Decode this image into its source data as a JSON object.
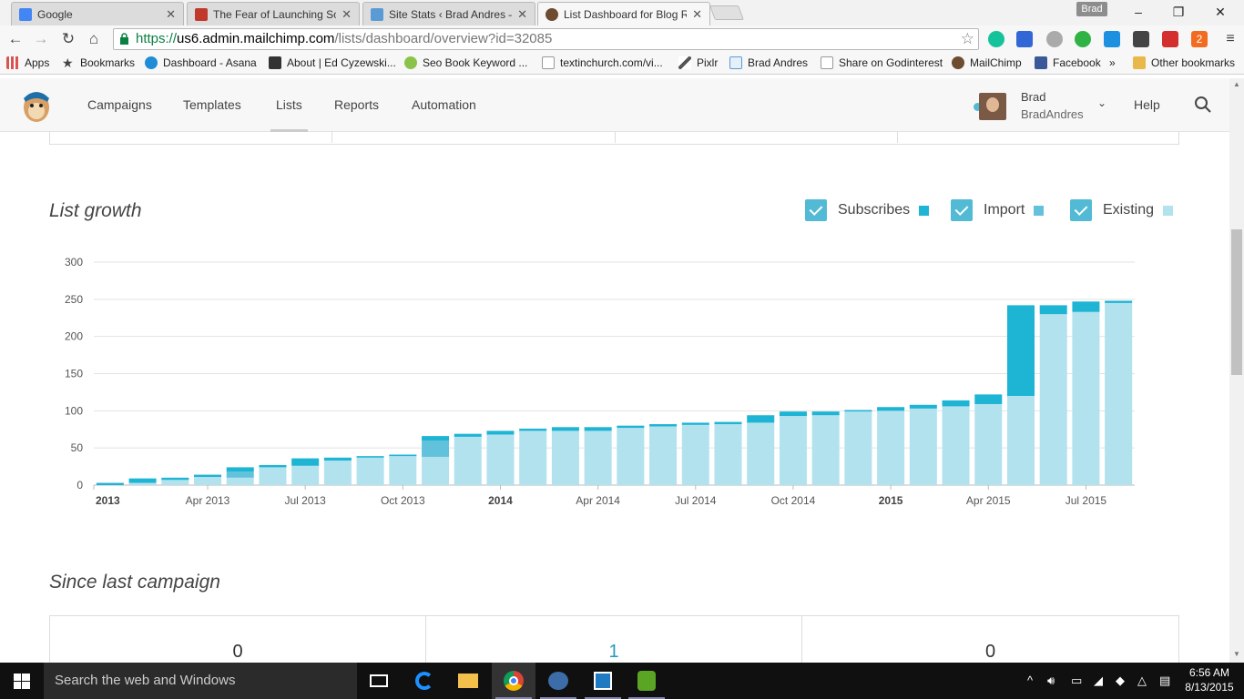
{
  "browser": {
    "tabs": [
      {
        "title": "Google",
        "favicon_color": "#4285f4",
        "active": false
      },
      {
        "title": "The Fear of Launching Sor",
        "favicon_color": "#c0392b",
        "active": false
      },
      {
        "title": "Site Stats ‹ Brad Andres —",
        "favicon_color": "#5b9bd5",
        "active": false
      },
      {
        "title": "List Dashboard for Blog R",
        "favicon_color": "#6d4c2f",
        "active": true
      }
    ],
    "profile_name": "Brad",
    "url": {
      "scheme": "https://",
      "host": "us6.admin.mailchimp.com",
      "path": "/lists/dashboard/overview?id=32085"
    },
    "extension_badge": "2",
    "bookmarks": [
      {
        "label": "Apps",
        "icon": "apps-grid-icon",
        "color": "#d9534f"
      },
      {
        "label": "Bookmarks",
        "icon": "star-icon",
        "color": "#444"
      },
      {
        "label": "Dashboard - Asana",
        "icon": "asana-icon",
        "color": "#1f8dd6"
      },
      {
        "label": "About | Ed Cyzewski...",
        "icon": "site-icon",
        "color": "#333"
      },
      {
        "label": "Seo Book Keyword ...",
        "icon": "seobook-icon",
        "color": "#8bc34a"
      },
      {
        "label": "textinchurch.com/vi...",
        "icon": "page-icon",
        "color": "#999"
      },
      {
        "label": "Pixlr",
        "icon": "pixlr-icon",
        "color": "#555"
      },
      {
        "label": "Brad Andres",
        "icon": "wp-stats-icon",
        "color": "#5b9bd5"
      },
      {
        "label": "Share on Godinterest",
        "icon": "page-icon",
        "color": "#999"
      },
      {
        "label": "MailChimp",
        "icon": "mailchimp-icon",
        "color": "#6d4c2f"
      },
      {
        "label": "Facebook",
        "icon": "facebook-icon",
        "color": "#3b5998"
      },
      {
        "label": "»",
        "icon": "more-icon",
        "color": "#444"
      },
      {
        "label": "Other bookmarks",
        "icon": "folder-icon",
        "color": "#e8b84a"
      }
    ]
  },
  "mailchimp": {
    "nav": [
      "Campaigns",
      "Templates",
      "Lists",
      "Reports",
      "Automation"
    ],
    "active_nav": "Lists",
    "user": {
      "name": "Brad",
      "username": "BradAndres"
    },
    "help": "Help"
  },
  "list_growth": {
    "title": "List growth",
    "legend": [
      {
        "label": "Subscribes",
        "color": "#1eb4d4"
      },
      {
        "label": "Import",
        "color": "#63c2db"
      },
      {
        "label": "Existing",
        "color": "#b2e2ee"
      }
    ]
  },
  "chart_data": {
    "type": "bar",
    "stacked": true,
    "ylim": [
      0,
      300
    ],
    "yticks": [
      0,
      50,
      100,
      150,
      200,
      250,
      300
    ],
    "xticks": [
      {
        "label": "2013",
        "bold": true,
        "index": 0
      },
      {
        "label": "Apr 2013",
        "bold": false,
        "index": 3
      },
      {
        "label": "Jul 2013",
        "bold": false,
        "index": 6
      },
      {
        "label": "Oct 2013",
        "bold": false,
        "index": 9
      },
      {
        "label": "2014",
        "bold": true,
        "index": 12
      },
      {
        "label": "Apr 2014",
        "bold": false,
        "index": 15
      },
      {
        "label": "Jul 2014",
        "bold": false,
        "index": 18
      },
      {
        "label": "Oct 2014",
        "bold": false,
        "index": 21
      },
      {
        "label": "2015",
        "bold": true,
        "index": 24
      },
      {
        "label": "Apr 2015",
        "bold": false,
        "index": 27
      },
      {
        "label": "Jul 2015",
        "bold": false,
        "index": 30
      }
    ],
    "categories": [
      "Jan 2013",
      "Feb 2013",
      "Mar 2013",
      "Apr 2013",
      "May 2013",
      "Jun 2013",
      "Jul 2013",
      "Aug 2013",
      "Sep 2013",
      "Oct 2013",
      "Nov 2013",
      "Dec 2013",
      "Jan 2014",
      "Feb 2014",
      "Mar 2014",
      "Apr 2014",
      "May 2014",
      "Jun 2014",
      "Jul 2014",
      "Aug 2014",
      "Sep 2014",
      "Oct 2014",
      "Nov 2014",
      "Dec 2014",
      "Jan 2015",
      "Feb 2015",
      "Mar 2015",
      "Apr 2015",
      "May 2015",
      "Jun 2015",
      "Jul 2015",
      "Aug 2015"
    ],
    "series": [
      {
        "name": "Existing",
        "color": "#b2e2ee",
        "values": [
          0,
          3,
          7,
          11,
          10,
          24,
          26,
          33,
          37,
          39,
          38,
          65,
          68,
          73,
          73,
          73,
          77,
          79,
          81,
          82,
          84,
          93,
          94,
          99,
          100,
          103,
          106,
          109,
          120,
          230,
          233,
          245
        ]
      },
      {
        "name": "Import",
        "color": "#63c2db",
        "values": [
          0,
          0,
          0,
          0,
          8,
          0,
          0,
          0,
          0,
          0,
          22,
          0,
          0,
          0,
          0,
          0,
          0,
          0,
          0,
          0,
          0,
          0,
          0,
          0,
          0,
          0,
          0,
          0,
          0,
          0,
          0,
          0
        ]
      },
      {
        "name": "Subscribes",
        "color": "#1eb4d4",
        "values": [
          3,
          6,
          3,
          3,
          6,
          3,
          10,
          4,
          2,
          2,
          6,
          4,
          5,
          3,
          5,
          5,
          3,
          3,
          3,
          3,
          10,
          6,
          5,
          2,
          5,
          5,
          8,
          13,
          122,
          12,
          14,
          3
        ]
      }
    ]
  },
  "since_last_campaign": {
    "title": "Since last campaign",
    "values": [
      "0",
      "1",
      "0"
    ]
  },
  "taskbar": {
    "search_placeholder": "Search the web and Windows",
    "time": "6:56 AM",
    "date": "8/13/2015"
  }
}
